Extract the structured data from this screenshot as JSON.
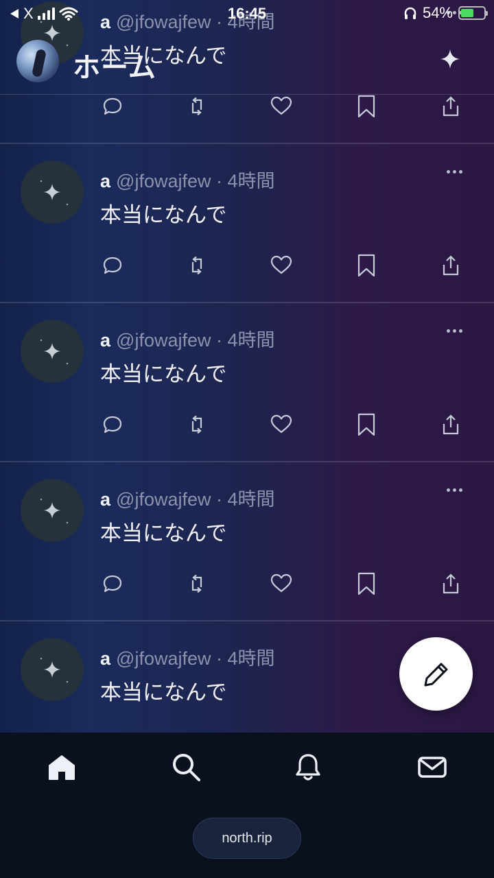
{
  "status_bar": {
    "back_label": "X",
    "time": "16:45",
    "battery": "54%"
  },
  "header": {
    "title": "ホーム",
    "sparkle_icon": "sparkle-icon"
  },
  "posts": [
    {
      "name": "a",
      "handle": "@jfowajfew · 4時間",
      "text": "本当になんで"
    },
    {
      "name": "a",
      "handle": "@jfowajfew · 4時間",
      "text": "本当になんで"
    },
    {
      "name": "a",
      "handle": "@jfowajfew · 4時間",
      "text": "本当になんで"
    },
    {
      "name": "a",
      "handle": "@jfowajfew · 4時間",
      "text": "本当になんで"
    },
    {
      "name": "a",
      "handle": "@jfowajfew · 4時間",
      "text": "本当になんで"
    }
  ],
  "post_actions": [
    "reply-icon",
    "repost-icon",
    "like-icon",
    "bookmark-icon",
    "share-icon"
  ],
  "fab": {
    "icon": "pencil-icon"
  },
  "bottom_nav": {
    "items": [
      "home-icon",
      "search-icon",
      "bell-icon",
      "mail-icon"
    ],
    "domain": "north.rip"
  },
  "colors": {
    "background_left": "#1a2b5c",
    "background_right": "#2d1a48",
    "nav_background": "#0a101d",
    "muted_text": "#8c93ab"
  }
}
